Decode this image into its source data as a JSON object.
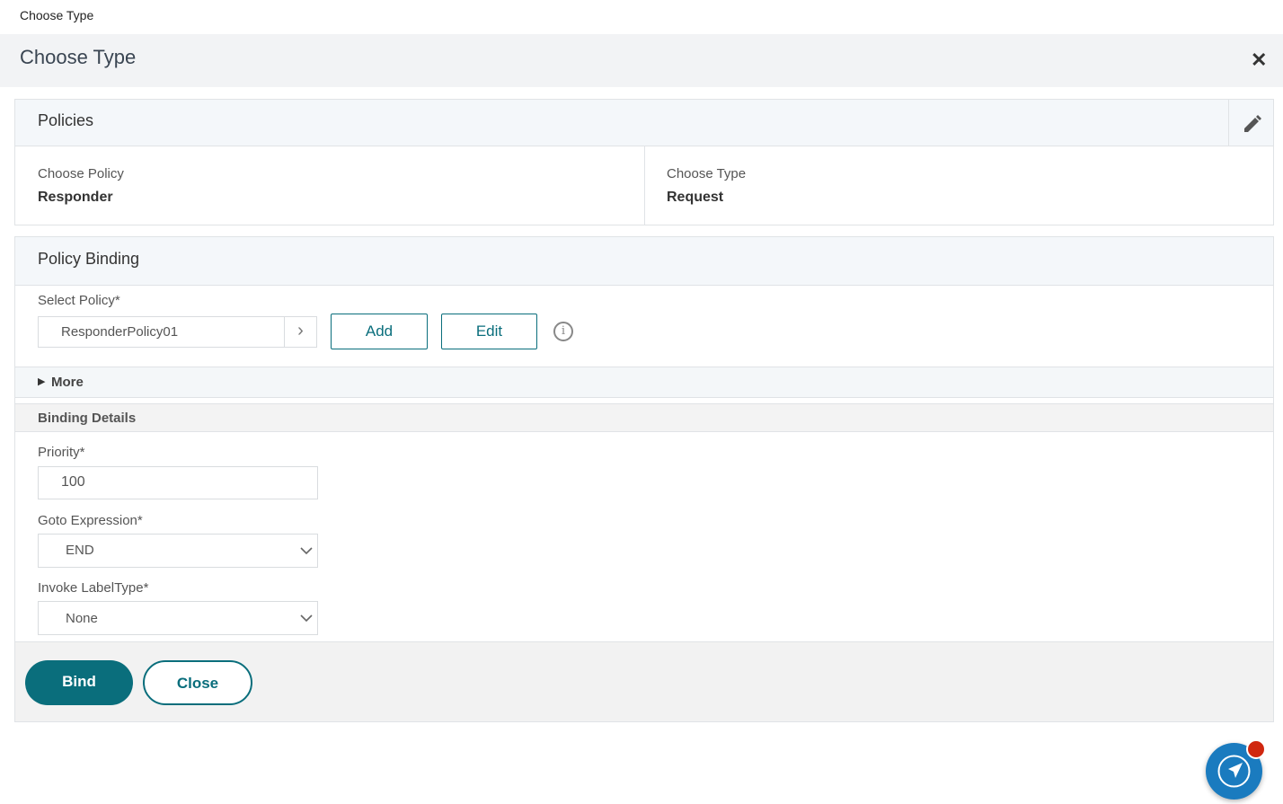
{
  "breadcrumb": "Choose Type",
  "header": {
    "title": "Choose Type"
  },
  "policies": {
    "title": "Policies",
    "choose_policy_label": "Choose Policy",
    "choose_policy_value": "Responder",
    "choose_type_label": "Choose Type",
    "choose_type_value": "Request"
  },
  "binding": {
    "title": "Policy Binding",
    "select_policy_label": "Select Policy*",
    "select_policy_value": "ResponderPolicy01",
    "add_label": "Add",
    "edit_label": "Edit",
    "more_label": "More",
    "details_title": "Binding Details",
    "priority_label": "Priority*",
    "priority_value": "100",
    "goto_label": "Goto Expression*",
    "goto_value": "END",
    "invoke_label": "Invoke LabelType*",
    "invoke_value": "None",
    "bind_label": "Bind",
    "close_label": "Close"
  },
  "colors": {
    "accent": "#0a6e7c",
    "fab": "#1a7bbf",
    "badge": "#d0270f"
  }
}
